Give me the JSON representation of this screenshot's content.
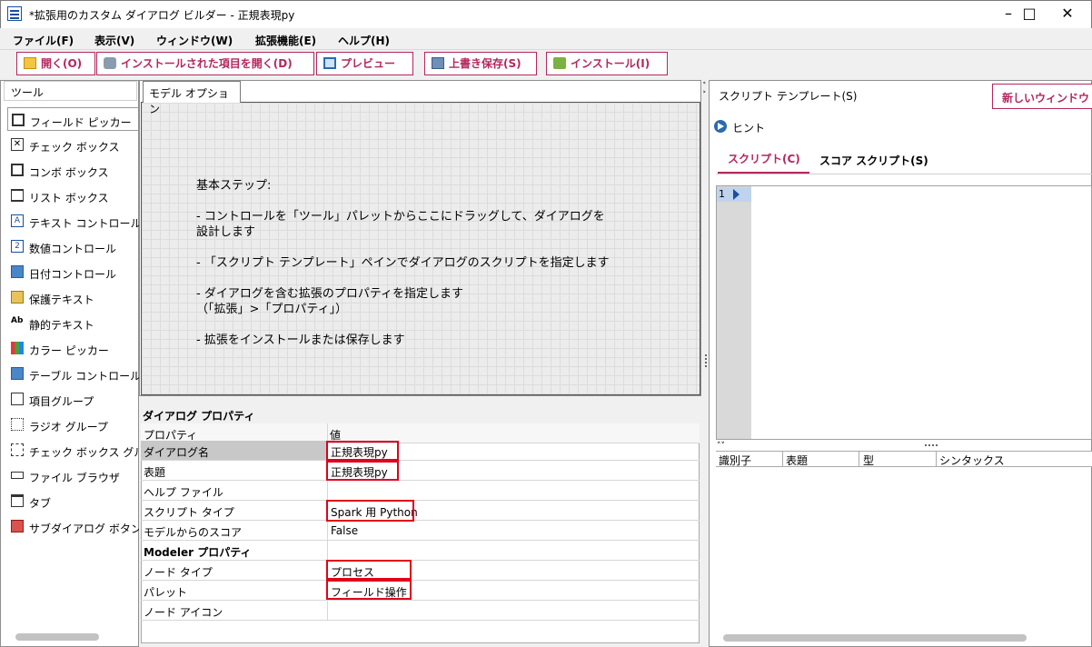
{
  "window": {
    "title": "*拡張用のカスタム ダイアログ ビルダー - 正規表現py"
  },
  "menu": [
    "ファイル(F)",
    "表示(V)",
    "ウィンドウ(W)",
    "拡張機能(E)",
    "ヘルプ(H)"
  ],
  "toolbar": {
    "open": "開く(O)",
    "open_installed": "インストールされた項目を開く(D)",
    "preview": "プレビュー",
    "save": "上書き保存(S)",
    "install": "インストール(I)"
  },
  "tools": {
    "header": "ツール",
    "items": [
      "フィールド ピッカー",
      "チェック ボックス",
      "コンボ ボックス",
      "リスト ボックス",
      "テキスト コントロール",
      "数値コントロール",
      "日付コントロール",
      "保護テキスト",
      "静的テキスト",
      "カラー ピッカー",
      "テーブル コントロール",
      "項目グループ",
      "ラジオ グループ",
      "チェック ボックス グループ",
      "ファイル ブラウザ",
      "タブ",
      "サブダイアログ ボタン"
    ]
  },
  "canvas": {
    "tab": "モデル オプション",
    "hints": [
      "基本ステップ:",
      "- コントロールを「ツール」パレットからここにドラッグして、ダイアログを",
      "設計します",
      "- 「スクリプト テンプレート」ペインでダイアログのスクリプトを指定します",
      "- ダイアログを含む拡張のプロパティを指定します",
      "（「拡張」>「プロパティ」）",
      "- 拡張をインストールまたは保存します"
    ]
  },
  "properties": {
    "title": "ダイアログ プロパティ",
    "col_property": "プロパティ",
    "col_value": "値",
    "rows": [
      {
        "name": "ダイアログ名",
        "value": "正規表現py"
      },
      {
        "name": "表題",
        "value": "正規表現py"
      },
      {
        "name": "ヘルプ ファイル",
        "value": ""
      },
      {
        "name": "スクリプト タイプ",
        "value": "Spark 用 Python"
      },
      {
        "name": "モデルからのスコア",
        "value": "False"
      },
      {
        "name": "Modeler プロパティ",
        "value": ""
      },
      {
        "name": "ノード タイプ",
        "value": "プロセス"
      },
      {
        "name": "パレット",
        "value": "フィールド操作"
      },
      {
        "name": "ノード アイコン",
        "value": ""
      }
    ]
  },
  "script": {
    "title": "スクリプト テンプレート(S)",
    "new_window": "新しいウィンドウ",
    "hint": "ヒント",
    "tabs": [
      "スクリプト(C)",
      "スコア スクリプト(S)"
    ],
    "line_number": "1",
    "columns": [
      "識別子",
      "表題",
      "型",
      "シンタックス"
    ]
  }
}
